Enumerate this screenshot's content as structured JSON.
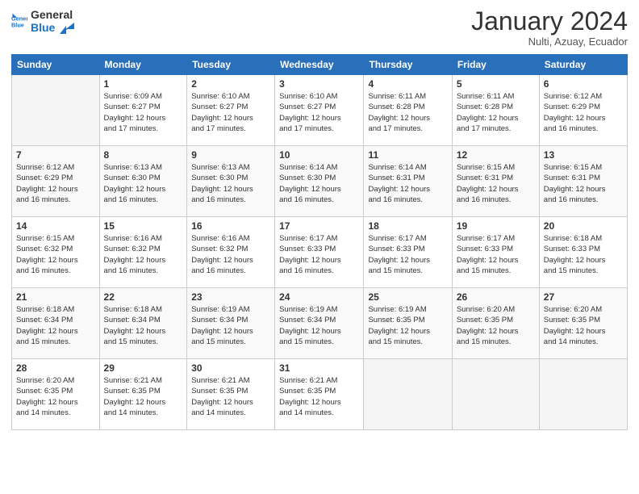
{
  "header": {
    "title": "January 2024",
    "location": "Nulti, Azuay, Ecuador"
  },
  "columns": [
    "Sunday",
    "Monday",
    "Tuesday",
    "Wednesday",
    "Thursday",
    "Friday",
    "Saturday"
  ],
  "weeks": [
    [
      {
        "day": "",
        "info": ""
      },
      {
        "day": "1",
        "info": "Sunrise: 6:09 AM\nSunset: 6:27 PM\nDaylight: 12 hours\nand 17 minutes."
      },
      {
        "day": "2",
        "info": "Sunrise: 6:10 AM\nSunset: 6:27 PM\nDaylight: 12 hours\nand 17 minutes."
      },
      {
        "day": "3",
        "info": "Sunrise: 6:10 AM\nSunset: 6:27 PM\nDaylight: 12 hours\nand 17 minutes."
      },
      {
        "day": "4",
        "info": "Sunrise: 6:11 AM\nSunset: 6:28 PM\nDaylight: 12 hours\nand 17 minutes."
      },
      {
        "day": "5",
        "info": "Sunrise: 6:11 AM\nSunset: 6:28 PM\nDaylight: 12 hours\nand 17 minutes."
      },
      {
        "day": "6",
        "info": "Sunrise: 6:12 AM\nSunset: 6:29 PM\nDaylight: 12 hours\nand 16 minutes."
      }
    ],
    [
      {
        "day": "7",
        "info": "Sunrise: 6:12 AM\nSunset: 6:29 PM\nDaylight: 12 hours\nand 16 minutes."
      },
      {
        "day": "8",
        "info": "Sunrise: 6:13 AM\nSunset: 6:30 PM\nDaylight: 12 hours\nand 16 minutes."
      },
      {
        "day": "9",
        "info": "Sunrise: 6:13 AM\nSunset: 6:30 PM\nDaylight: 12 hours\nand 16 minutes."
      },
      {
        "day": "10",
        "info": "Sunrise: 6:14 AM\nSunset: 6:30 PM\nDaylight: 12 hours\nand 16 minutes."
      },
      {
        "day": "11",
        "info": "Sunrise: 6:14 AM\nSunset: 6:31 PM\nDaylight: 12 hours\nand 16 minutes."
      },
      {
        "day": "12",
        "info": "Sunrise: 6:15 AM\nSunset: 6:31 PM\nDaylight: 12 hours\nand 16 minutes."
      },
      {
        "day": "13",
        "info": "Sunrise: 6:15 AM\nSunset: 6:31 PM\nDaylight: 12 hours\nand 16 minutes."
      }
    ],
    [
      {
        "day": "14",
        "info": "Sunrise: 6:15 AM\nSunset: 6:32 PM\nDaylight: 12 hours\nand 16 minutes."
      },
      {
        "day": "15",
        "info": "Sunrise: 6:16 AM\nSunset: 6:32 PM\nDaylight: 12 hours\nand 16 minutes."
      },
      {
        "day": "16",
        "info": "Sunrise: 6:16 AM\nSunset: 6:32 PM\nDaylight: 12 hours\nand 16 minutes."
      },
      {
        "day": "17",
        "info": "Sunrise: 6:17 AM\nSunset: 6:33 PM\nDaylight: 12 hours\nand 16 minutes."
      },
      {
        "day": "18",
        "info": "Sunrise: 6:17 AM\nSunset: 6:33 PM\nDaylight: 12 hours\nand 15 minutes."
      },
      {
        "day": "19",
        "info": "Sunrise: 6:17 AM\nSunset: 6:33 PM\nDaylight: 12 hours\nand 15 minutes."
      },
      {
        "day": "20",
        "info": "Sunrise: 6:18 AM\nSunset: 6:33 PM\nDaylight: 12 hours\nand 15 minutes."
      }
    ],
    [
      {
        "day": "21",
        "info": "Sunrise: 6:18 AM\nSunset: 6:34 PM\nDaylight: 12 hours\nand 15 minutes."
      },
      {
        "day": "22",
        "info": "Sunrise: 6:18 AM\nSunset: 6:34 PM\nDaylight: 12 hours\nand 15 minutes."
      },
      {
        "day": "23",
        "info": "Sunrise: 6:19 AM\nSunset: 6:34 PM\nDaylight: 12 hours\nand 15 minutes."
      },
      {
        "day": "24",
        "info": "Sunrise: 6:19 AM\nSunset: 6:34 PM\nDaylight: 12 hours\nand 15 minutes."
      },
      {
        "day": "25",
        "info": "Sunrise: 6:19 AM\nSunset: 6:35 PM\nDaylight: 12 hours\nand 15 minutes."
      },
      {
        "day": "26",
        "info": "Sunrise: 6:20 AM\nSunset: 6:35 PM\nDaylight: 12 hours\nand 15 minutes."
      },
      {
        "day": "27",
        "info": "Sunrise: 6:20 AM\nSunset: 6:35 PM\nDaylight: 12 hours\nand 14 minutes."
      }
    ],
    [
      {
        "day": "28",
        "info": "Sunrise: 6:20 AM\nSunset: 6:35 PM\nDaylight: 12 hours\nand 14 minutes."
      },
      {
        "day": "29",
        "info": "Sunrise: 6:21 AM\nSunset: 6:35 PM\nDaylight: 12 hours\nand 14 minutes."
      },
      {
        "day": "30",
        "info": "Sunrise: 6:21 AM\nSunset: 6:35 PM\nDaylight: 12 hours\nand 14 minutes."
      },
      {
        "day": "31",
        "info": "Sunrise: 6:21 AM\nSunset: 6:35 PM\nDaylight: 12 hours\nand 14 minutes."
      },
      {
        "day": "",
        "info": ""
      },
      {
        "day": "",
        "info": ""
      },
      {
        "day": "",
        "info": ""
      }
    ]
  ]
}
